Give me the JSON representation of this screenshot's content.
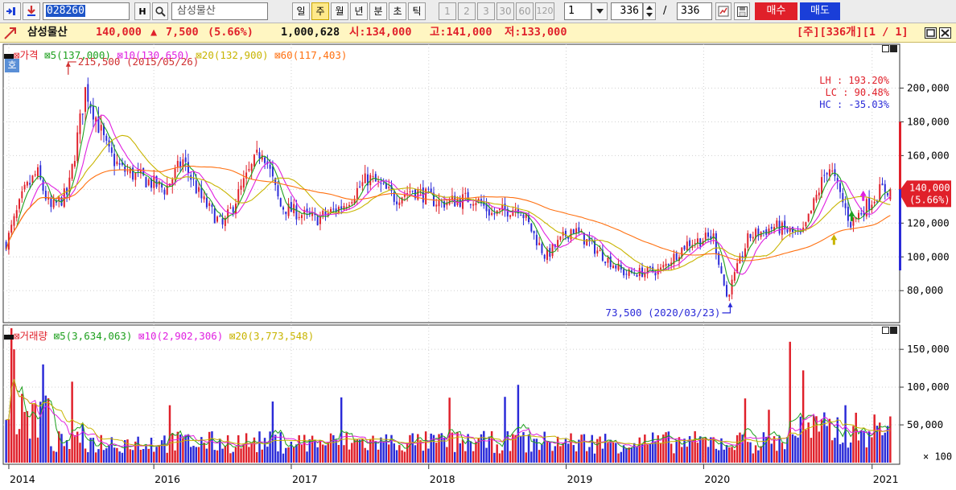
{
  "toolbar": {
    "code": "028260",
    "h_label": "H",
    "stock_name": "삼성물산",
    "periods": [
      "일",
      "주",
      "월",
      "년",
      "분",
      "초",
      "틱"
    ],
    "active_period": "주",
    "intervals": [
      "1",
      "2",
      "3",
      "30",
      "60",
      "120"
    ],
    "interval_value": "1",
    "count_shown": "336",
    "count_sep": "/",
    "count_total": "336",
    "buy_label": "매수",
    "sell_label": "매도"
  },
  "infobar": {
    "name": "삼성물산",
    "price": "140,000",
    "change_sign": "▲",
    "change": "7,500",
    "change_pct": "(5.66%)",
    "volume": "1,000,628",
    "open": "시:134,000",
    "high": "고:141,000",
    "low": "저:133,000",
    "right": "[주][336개][1 / 1]"
  },
  "colors": {
    "up": "#e0202a",
    "down": "#2a2ad8",
    "ma5": "#1ea01e",
    "ma10": "#e020e0",
    "ma20": "#c8b400",
    "ma60": "#ff7010"
  },
  "price_legend": {
    "title": "가격",
    "ma5": "5(137,000)",
    "ma10": "10(130,650)",
    "ma20": "20(132,900)",
    "ma60": "60(117,403)"
  },
  "volume_legend": {
    "title": "거래량",
    "ma5": "5(3,634,063)",
    "ma10": "10(2,902,306)",
    "ma20": "20(3,773,548)"
  },
  "stats": {
    "lh": "LH : 193.20%",
    "lc": "LC :  90.48%",
    "hc": "HC : -35.03%"
  },
  "badge": "호",
  "chart_data": {
    "type": "candlestick",
    "interval": "weekly",
    "x_ticks": [
      "2014",
      "2016",
      "2017",
      "2018",
      "2019",
      "2020",
      "2021"
    ],
    "price_axis": {
      "ticks": [
        "200,000",
        "180,000",
        "160,000",
        "140,000",
        "120,000",
        "100,000",
        "80,000"
      ],
      "range": [
        62000,
        225000
      ]
    },
    "volume_axis": {
      "ticks": [
        "150,000",
        "100,000",
        "50,000"
      ],
      "unit": "× 100"
    },
    "annotations": {
      "high": "215,500 (2015/05/26)",
      "low": "73,500 (2020/03/23)"
    },
    "last_price_tag": [
      "140,000",
      "(5.66%)"
    ],
    "trend_points": [
      [
        0.0,
        108000
      ],
      [
        0.02,
        138000
      ],
      [
        0.035,
        150000
      ],
      [
        0.05,
        128000
      ],
      [
        0.07,
        138000
      ],
      [
        0.09,
        200000
      ],
      [
        0.1,
        185000
      ],
      [
        0.115,
        162000
      ],
      [
        0.13,
        152000
      ],
      [
        0.16,
        145000
      ],
      [
        0.18,
        140000
      ],
      [
        0.2,
        157000
      ],
      [
        0.22,
        135000
      ],
      [
        0.245,
        118000
      ],
      [
        0.27,
        145000
      ],
      [
        0.29,
        165000
      ],
      [
        0.31,
        130000
      ],
      [
        0.35,
        122000
      ],
      [
        0.38,
        130000
      ],
      [
        0.41,
        147000
      ],
      [
        0.44,
        135000
      ],
      [
        0.46,
        140000
      ],
      [
        0.49,
        132000
      ],
      [
        0.53,
        135000
      ],
      [
        0.55,
        125000
      ],
      [
        0.58,
        130000
      ],
      [
        0.61,
        100000
      ],
      [
        0.64,
        117000
      ],
      [
        0.67,
        103000
      ],
      [
        0.7,
        90000
      ],
      [
        0.74,
        92000
      ],
      [
        0.77,
        108000
      ],
      [
        0.8,
        112000
      ],
      [
        0.815,
        76000
      ],
      [
        0.84,
        112000
      ],
      [
        0.87,
        118000
      ],
      [
        0.9,
        112000
      ],
      [
        0.93,
        155000
      ],
      [
        0.955,
        120000
      ],
      [
        0.99,
        140000
      ]
    ]
  }
}
